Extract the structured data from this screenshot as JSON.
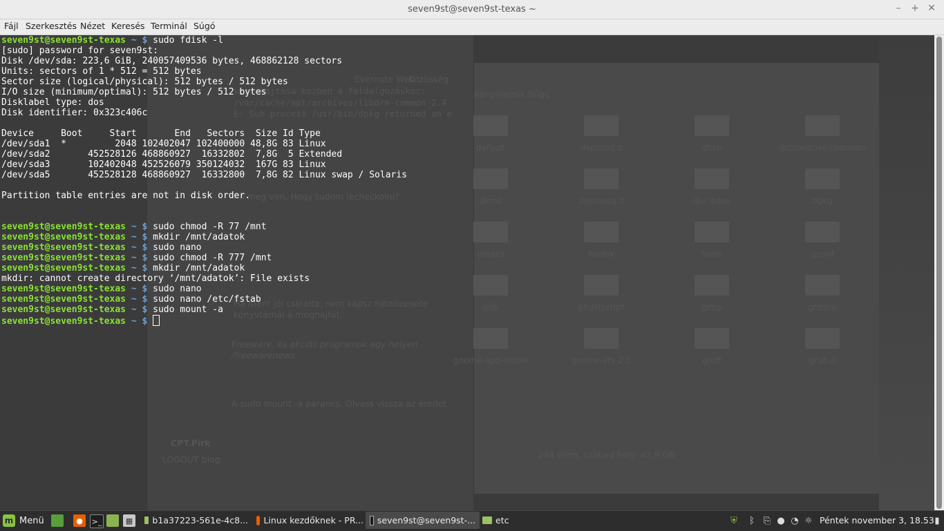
{
  "window": {
    "title": "seven9st@seven9st-texas ~",
    "minimize": "–",
    "maximize": "+",
    "close": "✕"
  },
  "menu": [
    "Fájl",
    "Szerkesztés",
    "Nézet",
    "Keresés",
    "Terminál",
    "Súgó"
  ],
  "terminal": {
    "prompt_user": "seven9st@seven9st-texas",
    "prompt_sep": " ~ $ ",
    "lines": {
      "l1": "sudo fdisk -l",
      "l2": "[sudo] password for seven9st:",
      "l3": "Disk /dev/sda: 223,6 GiB, 240057409536 bytes, 468862128 sectors",
      "l4": "Units: sectors of 1 * 512 = 512 bytes",
      "l5": "Sector size (logical/physical): 512 bytes / 512 bytes",
      "l6": "I/O size (minimum/optimal): 512 bytes / 512 bytes",
      "l7": "Disklabel type: dos",
      "l8": "Disk identifier: 0x323c406c",
      "l10": "Device     Boot     Start       End   Sectors  Size Id Type",
      "l11": "/dev/sda1  *         2048 102402047 102400000 48,8G 83 Linux",
      "l12": "/dev/sda2       452528126 468860927  16332802  7,8G  5 Extended",
      "l13": "/dev/sda3       102402048 452526079 350124032  167G 83 Linux",
      "l14": "/dev/sda5       452528128 468860927  16332800  7,8G 82 Linux swap / Solaris",
      "l16": "Partition table entries are not in disk order.",
      "l19": "sudo chmod -R 77 /mnt",
      "l20": "mkdir /mnt/adatok",
      "l21": "sudo nano",
      "l22": "sudo chmod -R 777 /mnt",
      "l23": "mkdir /mnt/adatok",
      "l24": "mkdir: cannot create directory ‘/mnt/adatok’: File exists",
      "l25": "sudo nano",
      "l26": "sudo nano /etc/fstab",
      "l27": "sudo mount -a"
    }
  },
  "background_window_text": {
    "browser": {
      "t1": "végrehajtása közben a feldolgozáskor:",
      "t2": "/var/cache/apt/archives/libdrm-common_2.4",
      "t3": "E: Sub-process /usr/bin/dpkg returned an e",
      "t4": "mi meg van. Hogy tudom lecheckolni?",
      "t5": "Ha ment jól csinálta, nem kapsz hibaüzenete",
      "t6": "könyvtárnál a meghajtót.",
      "t7": "Freeware, és akciós programok egy helyen",
      "t8": "/freewarenews",
      "t9": "A sudo mount -a parancs. Olvass vissza az eredet",
      "t10": "CPT.Pirk",
      "t11": "LOGOUT blog",
      "t12": "Evernote Web",
      "t13": "Közösség"
    },
    "file_manager": {
      "menu": "Könyvjelzők   Súgó",
      "status": "249 elem, szabad hely: 42,9 GB",
      "folders": [
        "default",
        "depmod.d",
        "dhcp",
        "dictionaries-common",
        "dkms",
        "dnsmasq.d",
        "doc-base",
        "dpkg",
        "emacs",
        "firefox",
        "fonts",
        "gconf",
        "gdb",
        "ghostscript",
        "gimp",
        "gnome",
        "gnome-app-install",
        "gnome-vfs-2.0",
        "groff",
        "grub.d"
      ]
    }
  },
  "panel": {
    "menu_label": "Menü",
    "tasks": [
      "b1a37223-561e-4c8...",
      "Linux kezdőknek - PR...",
      "seven9st@seven9st-...",
      "etc"
    ],
    "clock": "Péntek november  3, 18.53"
  },
  "colors": {
    "prompt_user": "#8ae234",
    "prompt_sep": "#729fcf",
    "terminal_bg": "#3b3b3b",
    "panel_bg": "#2d2d2d"
  }
}
